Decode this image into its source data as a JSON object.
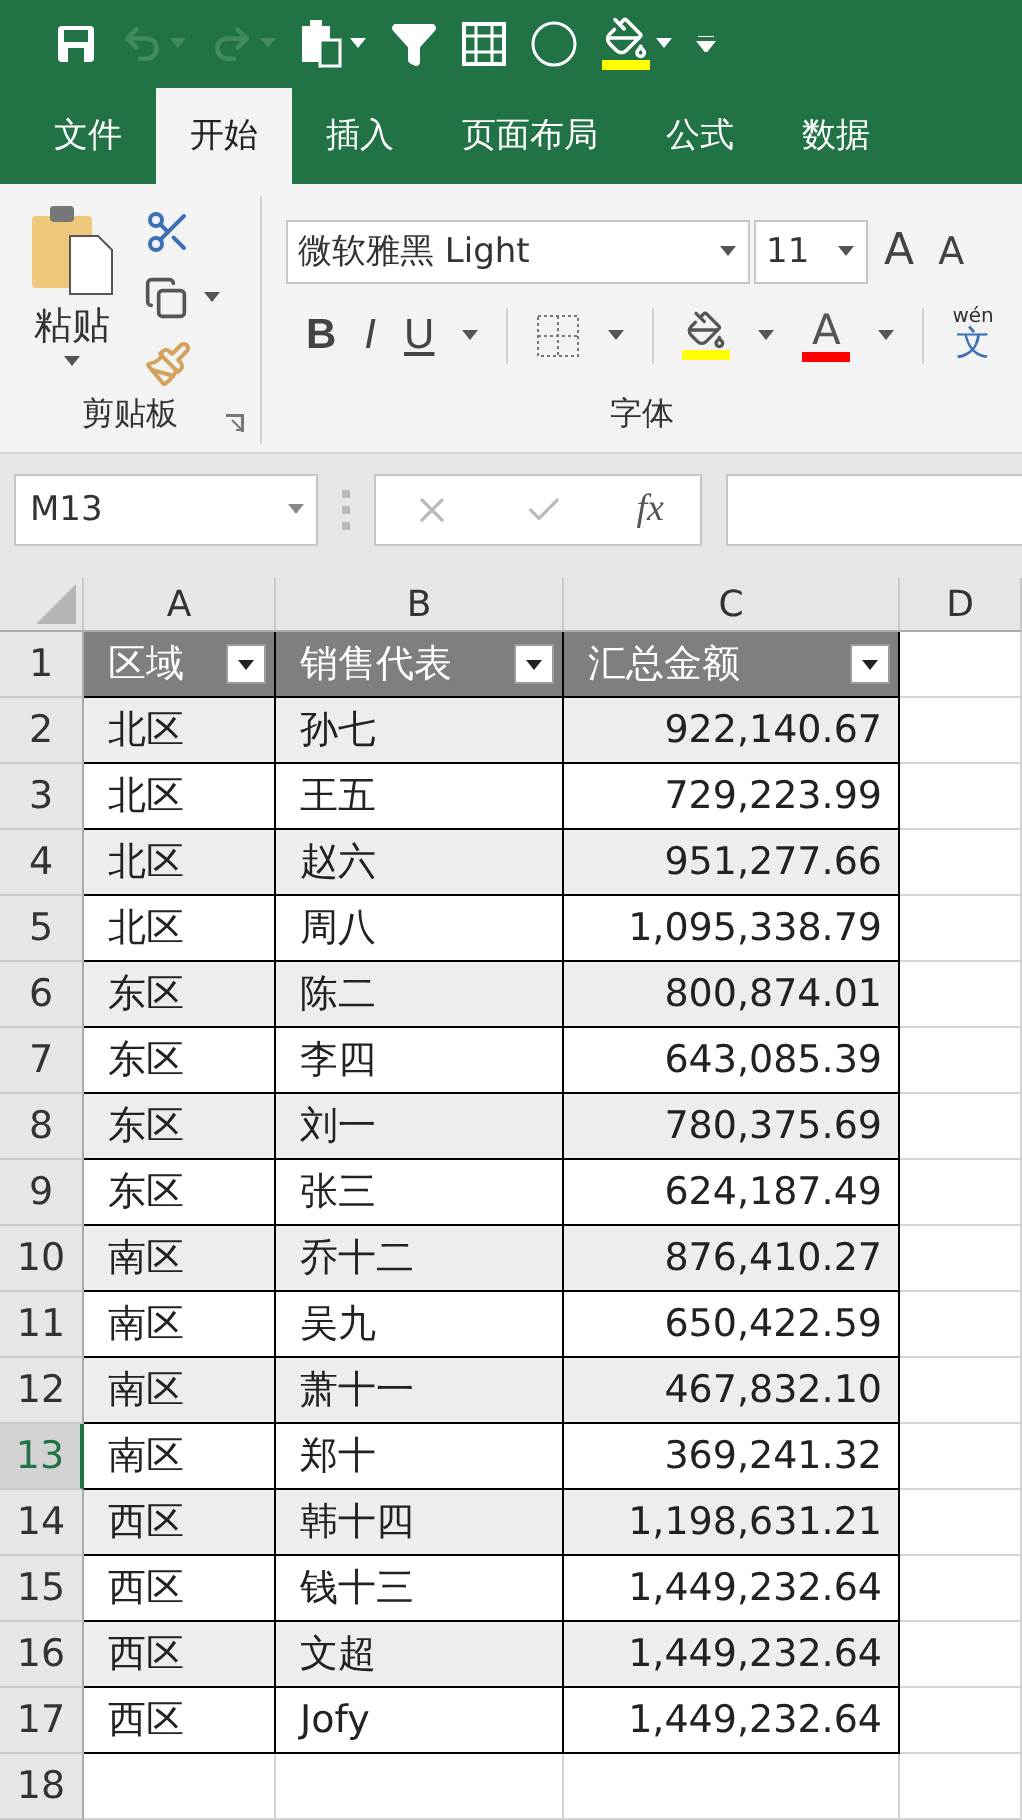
{
  "quick_access": [
    {
      "kind": "save",
      "disabled": false
    },
    {
      "kind": "undo",
      "disabled": true
    },
    {
      "kind": "redo",
      "disabled": true
    },
    {
      "kind": "paste",
      "disabled": false
    },
    {
      "kind": "filter",
      "disabled": false
    },
    {
      "kind": "form",
      "disabled": false
    },
    {
      "kind": "shape",
      "disabled": false
    },
    {
      "kind": "fill",
      "disabled": false
    },
    {
      "kind": "customize",
      "disabled": false
    }
  ],
  "tabs": [
    {
      "label": "文件",
      "selected": false
    },
    {
      "label": "开始",
      "selected": true
    },
    {
      "label": "插入",
      "selected": false
    },
    {
      "label": "页面布局",
      "selected": false
    },
    {
      "label": "公式",
      "selected": false
    },
    {
      "label": "数据",
      "selected": false
    }
  ],
  "ribbon": {
    "clipboard": {
      "paste_label": "粘贴",
      "group_label": "剪贴板"
    },
    "font": {
      "font_name": "微软雅黑 Light",
      "font_size": "11",
      "grow_font": "A",
      "shrink_font": "A",
      "bold": "B",
      "italic": "I",
      "underline": "U",
      "font_color": "A",
      "phonetic_top": "wén",
      "phonetic_char": "文",
      "group_label": "字体"
    }
  },
  "formula_bar": {
    "name_box": "M13",
    "function_label": "fx"
  },
  "sheet": {
    "columns": [
      "A",
      "B",
      "C",
      "D"
    ],
    "rows": [
      {
        "number": "1",
        "kind": "header",
        "selected": false,
        "cells": [
          "区域",
          "销售代表",
          "汇总金额"
        ]
      },
      {
        "number": "2",
        "kind": "data",
        "selected": false,
        "cells": [
          "北区",
          "孙七",
          "922,140.67"
        ]
      },
      {
        "number": "3",
        "kind": "data",
        "selected": false,
        "cells": [
          "北区",
          "王五",
          "729,223.99"
        ]
      },
      {
        "number": "4",
        "kind": "data",
        "selected": false,
        "cells": [
          "北区",
          "赵六",
          "951,277.66"
        ]
      },
      {
        "number": "5",
        "kind": "data",
        "selected": false,
        "cells": [
          "北区",
          "周八",
          "1,095,338.79"
        ]
      },
      {
        "number": "6",
        "kind": "data",
        "selected": false,
        "cells": [
          "东区",
          "陈二",
          "800,874.01"
        ]
      },
      {
        "number": "7",
        "kind": "data",
        "selected": false,
        "cells": [
          "东区",
          "李四",
          "643,085.39"
        ]
      },
      {
        "number": "8",
        "kind": "data",
        "selected": false,
        "cells": [
          "东区",
          "刘一",
          "780,375.69"
        ]
      },
      {
        "number": "9",
        "kind": "data",
        "selected": false,
        "cells": [
          "东区",
          "张三",
          "624,187.49"
        ]
      },
      {
        "number": "10",
        "kind": "data",
        "selected": false,
        "cells": [
          "南区",
          "乔十二",
          "876,410.27"
        ]
      },
      {
        "number": "11",
        "kind": "data",
        "selected": false,
        "cells": [
          "南区",
          "吴九",
          "650,422.59"
        ]
      },
      {
        "number": "12",
        "kind": "data",
        "selected": false,
        "cells": [
          "南区",
          "萧十一",
          "467,832.10"
        ]
      },
      {
        "number": "13",
        "kind": "data",
        "selected": true,
        "cells": [
          "南区",
          "郑十",
          "369,241.32"
        ]
      },
      {
        "number": "14",
        "kind": "data",
        "selected": false,
        "cells": [
          "西区",
          "韩十四",
          "1,198,631.21"
        ]
      },
      {
        "number": "15",
        "kind": "data",
        "selected": false,
        "cells": [
          "西区",
          "钱十三",
          "1,449,232.64"
        ]
      },
      {
        "number": "16",
        "kind": "data",
        "selected": false,
        "cells": [
          "西区",
          "文超",
          "1,449,232.64"
        ]
      },
      {
        "number": "17",
        "kind": "data",
        "selected": false,
        "cells": [
          "西区",
          "Jofy",
          "1,449,232.64"
        ]
      },
      {
        "number": "18",
        "kind": "empty",
        "selected": false,
        "cells": []
      }
    ]
  }
}
